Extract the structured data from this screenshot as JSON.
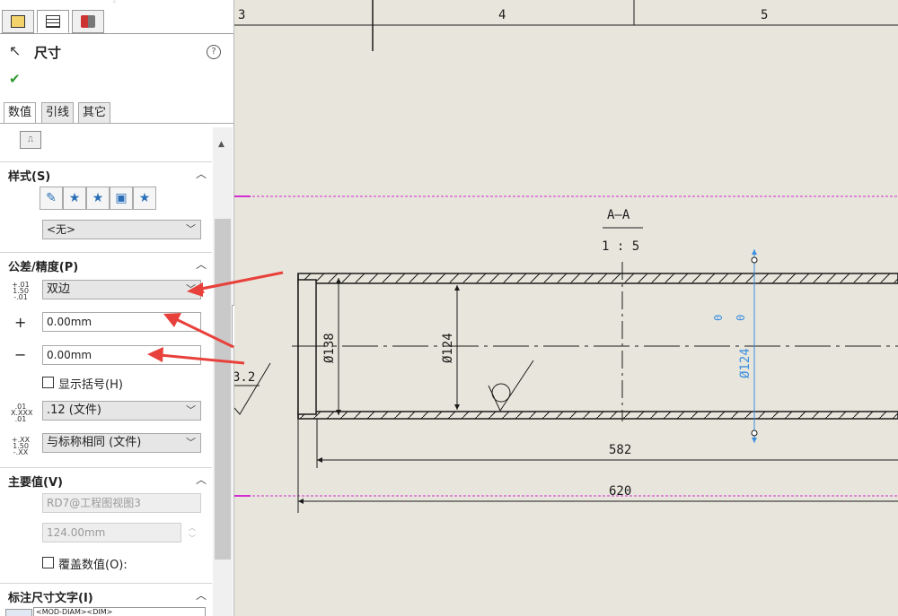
{
  "panel": {
    "header_title": "尺寸",
    "help_icon": "question-icon",
    "confirm_icon": "checkmark-icon",
    "subtabs": [
      "数值",
      "引线",
      "其它"
    ],
    "style_section": {
      "title": "样式(S)",
      "dropdown_value": "<无>"
    },
    "tolerance_section": {
      "title": "公差/精度(P)",
      "tolerance_icon_text": "+.01\n1.50\n-.01",
      "tolerance_type": "双边",
      "plus_symbol": "+",
      "plus_value": "0.00mm",
      "minus_symbol": "−",
      "minus_value": "0.00mm",
      "show_parentheses_label": "显示括号(H)",
      "precision_icon_text": ".01\nX.XXX\n.01",
      "precision_value": ".12 (文件)",
      "tol_precision_icon_text": "+.XX\n1.50\n-.XX",
      "tol_precision_value": "与标称相同 (文件)"
    },
    "primary_section": {
      "title": "主要值(V)",
      "reference": "RD7@工程图视图3",
      "value": "124.00mm",
      "override_label": "覆盖数值(O):"
    },
    "dim_text_section": {
      "title": "标注尺寸文字(I)",
      "text": "<MOD-DIAM><DIM>"
    }
  },
  "drawing": {
    "zones": [
      "3",
      "4",
      "5"
    ],
    "section_label": "A—A",
    "scale_label": "1 : 5",
    "dims": {
      "d138": "Ø138",
      "d124": "Ø124",
      "d124_selected": "Ø124",
      "len582": "582",
      "len620": "620",
      "left_partial": "3.2",
      "tol_upper": "0",
      "tol_lower": "0"
    },
    "colors": {
      "background": "#e8e6dc",
      "line": "#1a1a1a",
      "selected": "#3d8fe0",
      "border_magenta": "#d22bd2",
      "annotation_arrow": "#e8413c"
    }
  }
}
